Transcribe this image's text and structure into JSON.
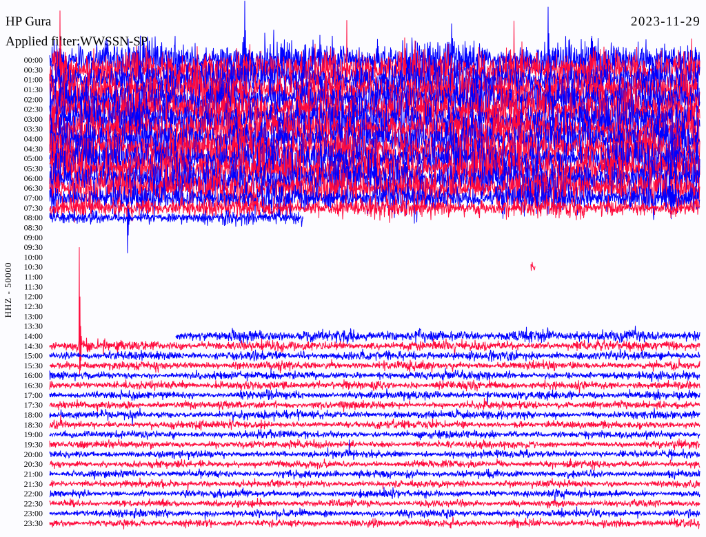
{
  "chart_data": {
    "type": "line",
    "title": "HP Gura",
    "date": "2023-11-29",
    "subtitle": "Applied filter:WWSSN-SP",
    "ylabel": "HHZ - 50000",
    "row_minutes": 30,
    "series_colors": [
      "#0000ff",
      "#ff0a3c"
    ],
    "background": "#fcfcff",
    "segments": [
      {
        "start": "00:00:00",
        "end": "08:11:42"
      },
      {
        "start": "10:52:12",
        "end": "10:52:24"
      },
      {
        "start": "14:05:49",
        "end": "24:00:00"
      }
    ],
    "peaks": [
      {
        "time": "00:09:00",
        "amplitude": 300000
      },
      {
        "time": "00:23:00",
        "amplitude": 270000
      },
      {
        "time": "00:30:29",
        "amplitude": 300000
      },
      {
        "time": "08:03:36",
        "amplitude": -180000
      },
      {
        "time": "14:31:22",
        "amplitude": 500000
      }
    ],
    "rows": [
      {
        "label": "00:00",
        "amplitude": 140000
      },
      {
        "label": "00:30",
        "amplitude": 140000
      },
      {
        "label": "01:00",
        "amplitude": 140000
      },
      {
        "label": "01:30",
        "amplitude": 140000
      },
      {
        "label": "02:00",
        "amplitude": 140000
      },
      {
        "label": "02:30",
        "amplitude": 140000
      },
      {
        "label": "03:00",
        "amplitude": 140000
      },
      {
        "label": "03:30",
        "amplitude": 140000
      },
      {
        "label": "04:00",
        "amplitude": 140000
      },
      {
        "label": "04:30",
        "amplitude": 140000
      },
      {
        "label": "05:00",
        "amplitude": 140000
      },
      {
        "label": "05:30",
        "amplitude": 140000
      },
      {
        "label": "06:00",
        "amplitude": 135000
      },
      {
        "label": "06:30",
        "amplitude": 125000
      },
      {
        "label": "07:00",
        "amplitude": 100000
      },
      {
        "label": "07:30",
        "amplitude": 70000
      },
      {
        "label": "08:00",
        "amplitude": 45000
      },
      {
        "label": "08:30",
        "amplitude": null
      },
      {
        "label": "09:00",
        "amplitude": null
      },
      {
        "label": "09:30",
        "amplitude": null
      },
      {
        "label": "10:00",
        "amplitude": null
      },
      {
        "label": "10:30",
        "amplitude": 35000
      },
      {
        "label": "11:00",
        "amplitude": null
      },
      {
        "label": "11:30",
        "amplitude": null
      },
      {
        "label": "12:00",
        "amplitude": null
      },
      {
        "label": "12:30",
        "amplitude": null
      },
      {
        "label": "13:00",
        "amplitude": null
      },
      {
        "label": "13:30",
        "amplitude": null
      },
      {
        "label": "14:00",
        "amplitude": 40000
      },
      {
        "label": "14:30",
        "amplitude": 34000
      },
      {
        "label": "15:00",
        "amplitude": 30000
      },
      {
        "label": "15:30",
        "amplitude": 28000
      },
      {
        "label": "16:00",
        "amplitude": 28000
      },
      {
        "label": "16:30",
        "amplitude": 28000
      },
      {
        "label": "17:00",
        "amplitude": 27000
      },
      {
        "label": "17:30",
        "amplitude": 27000
      },
      {
        "label": "18:00",
        "amplitude": 26000
      },
      {
        "label": "18:30",
        "amplitude": 26000
      },
      {
        "label": "19:00",
        "amplitude": 25000
      },
      {
        "label": "19:30",
        "amplitude": 25000
      },
      {
        "label": "20:00",
        "amplitude": 25000
      },
      {
        "label": "20:30",
        "amplitude": 24000
      },
      {
        "label": "21:00",
        "amplitude": 24000
      },
      {
        "label": "21:30",
        "amplitude": 24000
      },
      {
        "label": "22:00",
        "amplitude": 24000
      },
      {
        "label": "22:30",
        "amplitude": 24000
      },
      {
        "label": "23:00",
        "amplitude": 25000
      },
      {
        "label": "23:30",
        "amplitude": 26000
      }
    ]
  }
}
